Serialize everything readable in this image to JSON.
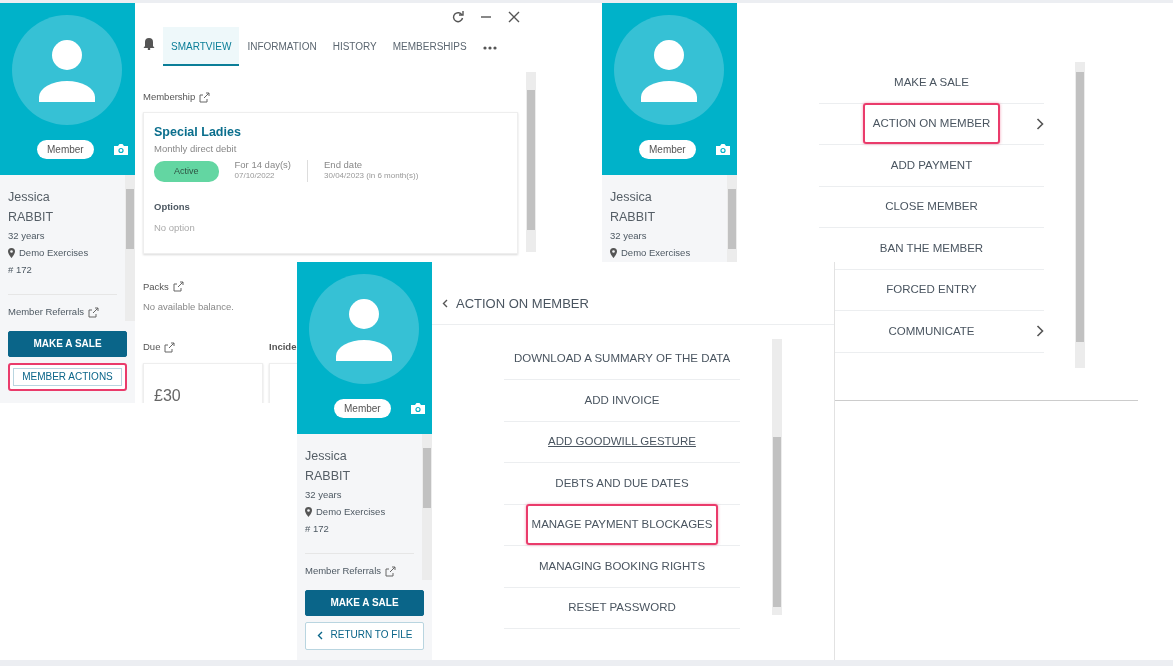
{
  "smartview_panel": {
    "profile": {
      "badge": "Member",
      "first_name": "Jessica",
      "last_name": "RABBIT",
      "age": "32 years",
      "location": "Demo Exercises",
      "number": "# 172",
      "referrals": "Member Referrals"
    },
    "buttons": [
      {
        "label": "MAKE A SALE",
        "kind": "primary",
        "highlighted": false
      },
      {
        "label": "MEMBER ACTIONS",
        "kind": "outline",
        "highlighted": true
      }
    ],
    "tabs": [
      {
        "label": "SMARTVIEW",
        "selected": true
      },
      {
        "label": "INFORMATION",
        "selected": false
      },
      {
        "label": "HISTORY",
        "selected": false
      },
      {
        "label": "MEMBERSHIPS",
        "selected": false
      }
    ],
    "membership": {
      "heading": "Membership",
      "name": "Special Ladies",
      "subtitle": "Monthly direct debit",
      "status": "Active",
      "duration": "For 14 day(s)",
      "start": "07/10/2022",
      "end_label": "End date",
      "end": "30/04/2023 (in 6 month(s))",
      "options_heading": "Options",
      "options_value": "No option"
    },
    "packs": {
      "heading": "Packs",
      "value": "No available balance."
    },
    "due": {
      "heading": "Due",
      "amount": "£30"
    },
    "incidents_heading": "Incide"
  },
  "actions_menu_panel": {
    "profile": {
      "badge": "Member",
      "first_name": "Jessica",
      "last_name": "RABBIT",
      "age": "32 years",
      "location": "Demo Exercises"
    },
    "items": [
      {
        "label": "MAKE A SALE",
        "has_submenu": false,
        "highlighted": false
      },
      {
        "label": "ACTION ON MEMBER",
        "has_submenu": true,
        "highlighted": true
      },
      {
        "label": "ADD PAYMENT",
        "has_submenu": false,
        "highlighted": false
      },
      {
        "label": "CLOSE MEMBER",
        "has_submenu": false,
        "highlighted": false
      },
      {
        "label": "BAN THE MEMBER",
        "has_submenu": false,
        "highlighted": false
      },
      {
        "label": "FORCED ENTRY",
        "has_submenu": false,
        "highlighted": false
      },
      {
        "label": "COMMUNICATE",
        "has_submenu": true,
        "highlighted": false
      }
    ]
  },
  "action_on_member_panel": {
    "profile": {
      "badge": "Member",
      "first_name": "Jessica",
      "last_name": "RABBIT",
      "age": "32 years",
      "location": "Demo Exercises",
      "number": "# 172",
      "referrals": "Member Referrals"
    },
    "buttons": [
      {
        "label": "MAKE A SALE",
        "kind": "primary",
        "highlighted": false
      },
      {
        "label": "RETURN TO FILE",
        "kind": "back",
        "highlighted": false
      }
    ],
    "title": "ACTION ON MEMBER",
    "items": [
      {
        "label": "DOWNLOAD A SUMMARY OF THE DATA",
        "underlined": false,
        "highlighted": false
      },
      {
        "label": "ADD INVOICE",
        "underlined": false,
        "highlighted": false
      },
      {
        "label": "ADD GOODWILL GESTURE",
        "underlined": true,
        "highlighted": false
      },
      {
        "label": "DEBTS AND DUE DATES",
        "underlined": false,
        "highlighted": false
      },
      {
        "label": "MANAGE PAYMENT BLOCKAGES",
        "underlined": false,
        "highlighted": true
      },
      {
        "label": "MANAGING BOOKING RIGHTS",
        "underlined": false,
        "highlighted": false
      },
      {
        "label": "RESET PASSWORD",
        "underlined": false,
        "highlighted": false
      }
    ]
  }
}
